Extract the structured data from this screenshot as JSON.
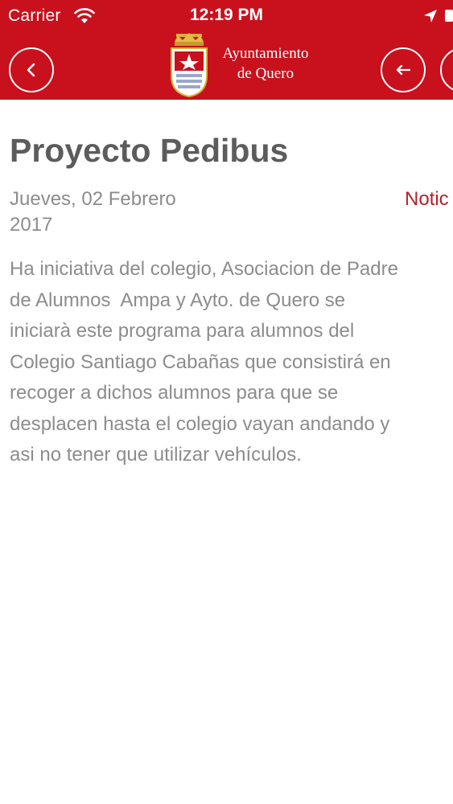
{
  "status_bar": {
    "carrier": "Carrier",
    "time": "12:19 PM"
  },
  "header": {
    "brand_line1": "Ayuntamiento",
    "brand_line2": "de Quero",
    "icons": [
      "back-chevron-icon",
      "crest-icon",
      "arrow-left-icon"
    ]
  },
  "article": {
    "title": "Proyecto Pedibus",
    "date_line1": "Jueves, 02 Febrero",
    "date_line2": "2017",
    "category": "Notic",
    "body_lines": [
      "Ha iniciativa del colegio, Asociacion de Padre",
      "de Alumnos  Ampa y Ayto. de Quero se",
      "iniciarà este programa para alumnos del",
      "Colegio Santiago Cabañas que consistirá en",
      "recoger a dichos alumnos para que se",
      "desplacen hasta el colegio vayan andando y",
      "asi no tener que utilizar vehículos."
    ]
  },
  "colors": {
    "header_red": "#c8111d",
    "category_red": "#b6202b",
    "text_gray": "#8c8c8c",
    "title_gray": "#5c5c5c"
  }
}
